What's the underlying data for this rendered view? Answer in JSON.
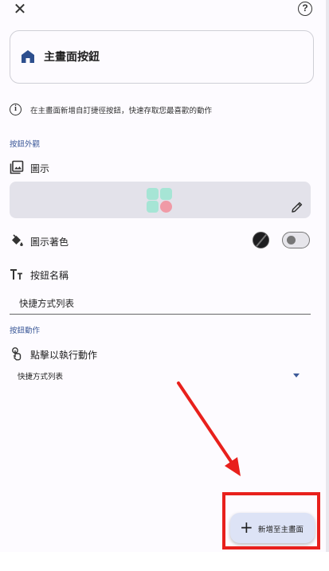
{
  "header": {
    "close_icon": "close-icon",
    "help_icon": "help-icon"
  },
  "preview": {
    "icon": "home-icon",
    "title": "主畫面按鈕",
    "icon_color": "#2d4f8e"
  },
  "info": {
    "icon": "info-icon",
    "text": "在主畫面新增自訂捷徑按鈕，快速存取您最喜歡的動作"
  },
  "appearance": {
    "section_label": "按鈕外觀",
    "icon_row_label": "圖示",
    "icon_tint_label": "圖示著色",
    "icon_tint_color": "#1d1d1f",
    "icon_tint_toggle_on": false,
    "button_name_label": "按鈕名稱",
    "button_name_value": "快捷方式列表"
  },
  "action": {
    "section_label": "按鈕動作",
    "tap_label": "點擊以執行動作",
    "selected_action": "快捷方式列表"
  },
  "fab": {
    "label": "新增至主畫面",
    "background": "#dde3f6"
  },
  "annotation_color": "#e8201c",
  "accent_color": "#3d5a99"
}
